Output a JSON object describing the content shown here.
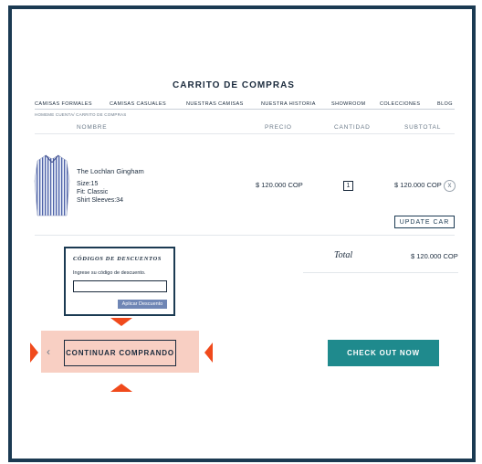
{
  "page": {
    "title": "CARRITO DE COMPRAS"
  },
  "nav": {
    "items": [
      "CAMISAS FORMALES",
      "CAMISAS CASUALES",
      "NUESTRAS CAMISAS",
      "NUESTRA HISTORIA",
      "SHOWROOM",
      "COLECCIONES",
      "BLOG"
    ]
  },
  "breadcrumb": "HOMEME CUENTA/ CARRITO DE COMPRAS",
  "columns": {
    "name": "NOMBRE",
    "price": "PRECIO",
    "qty": "CANTIDAD",
    "subtotal": "SUBTOTAL"
  },
  "item": {
    "name": "The Lochlan Gingham",
    "size": "Size:15",
    "fit": "Fit: Classic",
    "sleeves": "Shirt Sleeves:34",
    "price": "$ 120.000 COP",
    "qty": "1",
    "subtotal": "$ 120.000 COP",
    "remove": "x",
    "image_icon": "shirt-icon"
  },
  "update_label": "UPDATE CAR",
  "total": {
    "label": "Total",
    "value": "$ 120.000 COP"
  },
  "discount": {
    "heading": "CÓDIGOS DE DESCUENTOS",
    "prompt": "Ingrese su código de descuento.",
    "input_value": "",
    "button": "Aplicar Descuento"
  },
  "actions": {
    "continue": "CONTINUAR COMPRANDO",
    "back_glyph": "‹",
    "checkout": "CHECK OUT NOW"
  },
  "colors": {
    "frame": "#1b3a52",
    "checkout": "#1f8a8d",
    "highlight": "#f8cfc3",
    "marker": "#f04a1c",
    "discount_button": "#6f86b5"
  }
}
